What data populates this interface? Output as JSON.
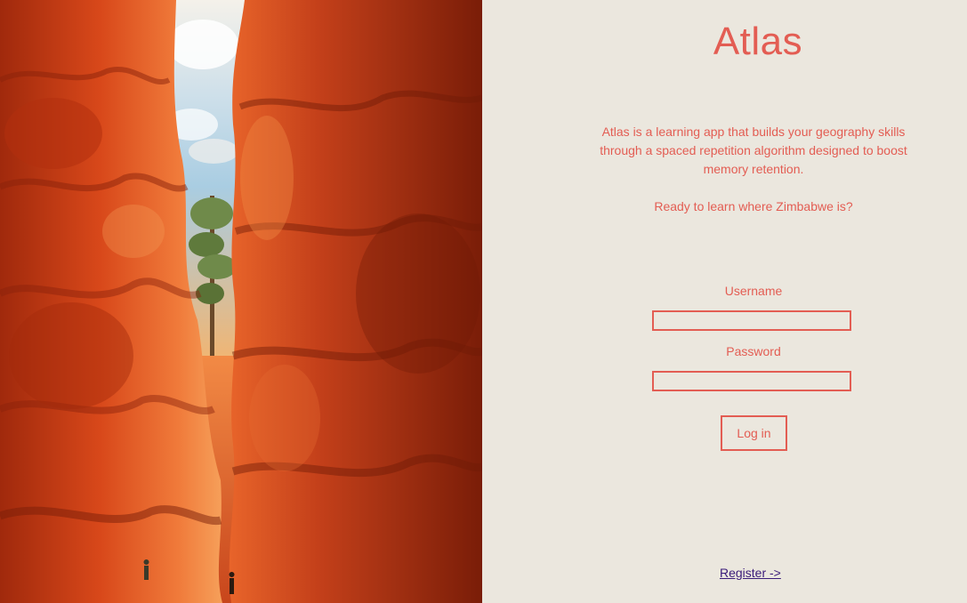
{
  "app": {
    "title": "Atlas"
  },
  "intro": {
    "description": "Atlas is a learning app that builds your geography skills through a spaced repetition algorithm designed to boost memory retention.",
    "prompt": "Ready to learn where Zimbabwe is?"
  },
  "form": {
    "username_label": "Username",
    "username_value": "",
    "password_label": "Password",
    "password_value": "",
    "login_label": "Log in"
  },
  "footer": {
    "register_label": "Register ->"
  },
  "colors": {
    "accent": "#e35d53",
    "panel_background": "#ebe7de",
    "link": "#3b1c7a"
  }
}
